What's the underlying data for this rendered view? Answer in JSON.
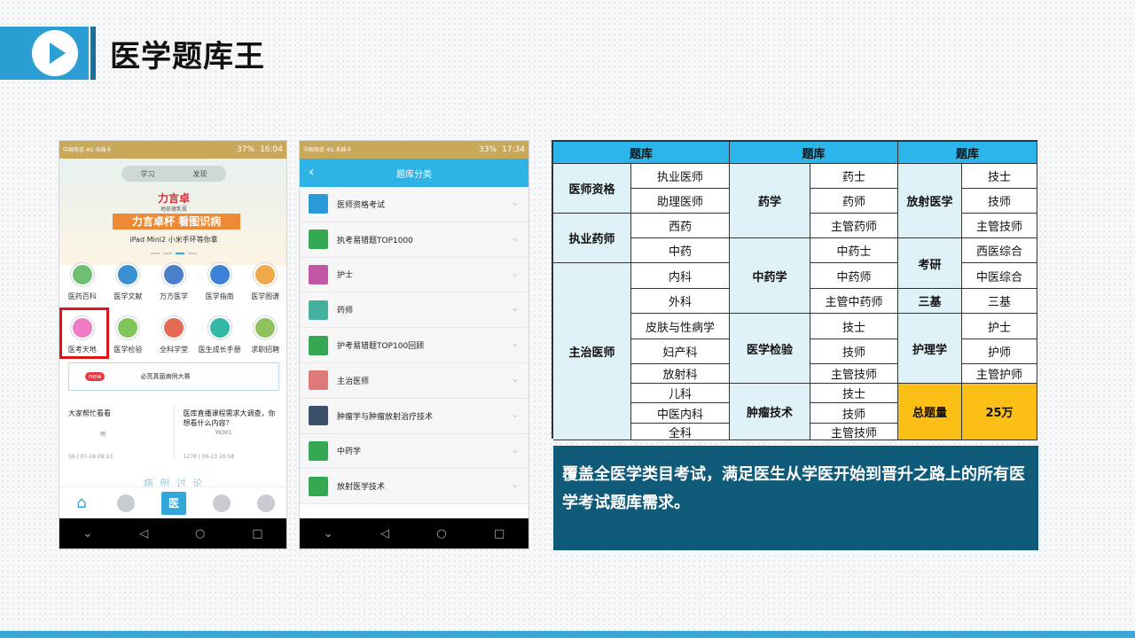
{
  "header": {
    "title": "医学题库王"
  },
  "phone1": {
    "status": {
      "carrier": "中国电信 4G\n未插卡",
      "battery": "37%",
      "time": "16:04"
    },
    "tabs": [
      "学习",
      "发现"
    ],
    "banner": {
      "brand": "力言卓",
      "brand_sub": "地奈德乳膏",
      "slogan": "力言卓杯 看图识病",
      "prize": "iPad Mini2 小米手环等你拿"
    },
    "grid": [
      {
        "label": "医药百科",
        "color": "#6fbf73"
      },
      {
        "label": "医学文献",
        "color": "#3a8fd1"
      },
      {
        "label": "万方医学",
        "color": "#4c7fc9"
      },
      {
        "label": "医学指南",
        "color": "#3b82d6"
      },
      {
        "label": "医学图谱",
        "color": "#f0a94a"
      },
      {
        "label": "医考天地",
        "color": "#ef7cc4"
      },
      {
        "label": "医学检验",
        "color": "#7fc55a"
      },
      {
        "label": "全科学堂",
        "color": "#e66b56"
      },
      {
        "label": "医生成长手册",
        "color": "#34b9a6"
      },
      {
        "label": "求职招聘",
        "color": "#8fc15c"
      }
    ],
    "ad": {
      "badge": "new",
      "text": "必亮真菌病例大赛"
    },
    "posts": [
      {
        "title": "大家帮忙看看",
        "author": "明",
        "meta": "56 | 07-18 09:13"
      },
      {
        "title": "医库直播课程需求大调查，你想看什么内容？",
        "author": "YK001",
        "meta": "1278 | 06-23 16:58"
      }
    ],
    "case_title": "病 例 讨 论",
    "tab_active": "医"
  },
  "phone2": {
    "status": {
      "carrier": "中国电信 4G\n未插卡",
      "battery": "33%",
      "time": "17:34"
    },
    "title": "题库分类",
    "items": [
      {
        "label": "医师资格考试",
        "color": "#2a9bd6"
      },
      {
        "label": "执考易错题TOP1000",
        "color": "#34a853"
      },
      {
        "label": "护士",
        "color": "#c157a5"
      },
      {
        "label": "药师",
        "color": "#45b2a0"
      },
      {
        "label": "护考易错题TOP100回顾",
        "color": "#34a853"
      },
      {
        "label": "主治医师",
        "color": "#e07a7a"
      },
      {
        "label": "肿瘤学与肿瘤放射治疗技术",
        "color": "#3b4f6a"
      },
      {
        "label": "中药学",
        "color": "#34a853"
      },
      {
        "label": "放射医学技术",
        "color": "#34a853"
      }
    ]
  },
  "table": {
    "headers": [
      "题库",
      "题库",
      "题库"
    ],
    "col1": {
      "groups": [
        {
          "name": "医师资格",
          "items": [
            "执业医师",
            "助理医师"
          ]
        },
        {
          "name": "执业药师",
          "items": [
            "西药",
            "中药"
          ]
        },
        {
          "name": "主治医师",
          "items": [
            "内科",
            "外科",
            "皮肤与性病学",
            "妇产科",
            "放射科",
            "儿科",
            "中医内科",
            "全科"
          ]
        }
      ]
    },
    "col2": {
      "groups": [
        {
          "name": "药学",
          "items": [
            "药士",
            "药师",
            "主管药师"
          ]
        },
        {
          "name": "中药学",
          "items": [
            "中药士",
            "中药师",
            "主管中药师"
          ]
        },
        {
          "name": "医学检验",
          "items": [
            "技士",
            "技师",
            "主管技师"
          ]
        },
        {
          "name": "肿瘤技术",
          "items": [
            "技士",
            "技师",
            "主管技师"
          ]
        }
      ]
    },
    "col3": {
      "groups": [
        {
          "name": "放射医学",
          "items": [
            "技士",
            "技师",
            "主管技师"
          ]
        },
        {
          "name": "考研",
          "items": [
            "西医综合",
            "中医综合"
          ]
        },
        {
          "name": "三基",
          "items": [
            "三基"
          ]
        },
        {
          "name": "护理学",
          "items": [
            "护士",
            "护师",
            "主管护师"
          ]
        }
      ],
      "total_label": "总题量",
      "total_value": "25万"
    }
  },
  "caption": "覆盖全医学类目考试，满足医生从学医开始到晋升之路上的所有医学考试题库需求。",
  "colors": {
    "accent": "#2b9fd3",
    "table_header": "#2cb5ea",
    "highlight": "#fbbf16",
    "caption_bg": "#0e5a78"
  }
}
